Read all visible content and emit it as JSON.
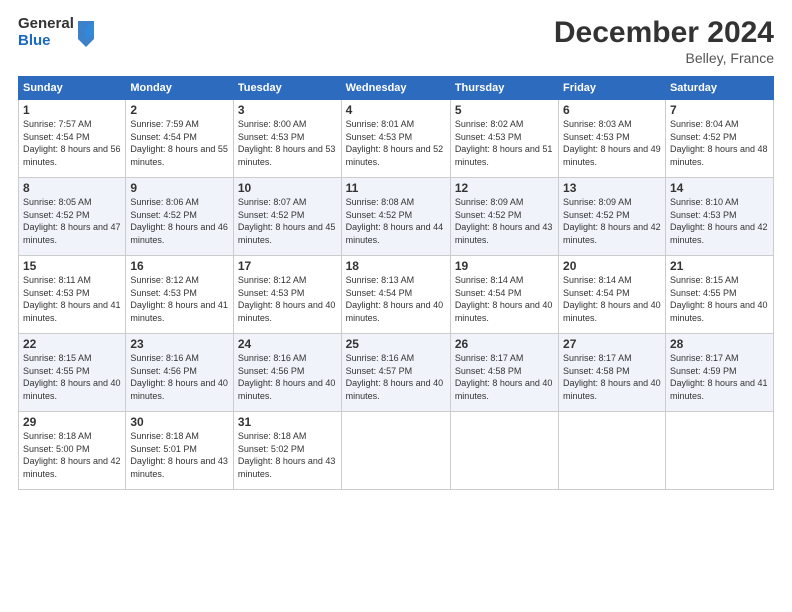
{
  "header": {
    "logo_general": "General",
    "logo_blue": "Blue",
    "month_title": "December 2024",
    "location": "Belley, France"
  },
  "weekdays": [
    "Sunday",
    "Monday",
    "Tuesday",
    "Wednesday",
    "Thursday",
    "Friday",
    "Saturday"
  ],
  "weeks": [
    [
      {
        "day": "1",
        "sunrise": "Sunrise: 7:57 AM",
        "sunset": "Sunset: 4:54 PM",
        "daylight": "Daylight: 8 hours and 56 minutes."
      },
      {
        "day": "2",
        "sunrise": "Sunrise: 7:59 AM",
        "sunset": "Sunset: 4:54 PM",
        "daylight": "Daylight: 8 hours and 55 minutes."
      },
      {
        "day": "3",
        "sunrise": "Sunrise: 8:00 AM",
        "sunset": "Sunset: 4:53 PM",
        "daylight": "Daylight: 8 hours and 53 minutes."
      },
      {
        "day": "4",
        "sunrise": "Sunrise: 8:01 AM",
        "sunset": "Sunset: 4:53 PM",
        "daylight": "Daylight: 8 hours and 52 minutes."
      },
      {
        "day": "5",
        "sunrise": "Sunrise: 8:02 AM",
        "sunset": "Sunset: 4:53 PM",
        "daylight": "Daylight: 8 hours and 51 minutes."
      },
      {
        "day": "6",
        "sunrise": "Sunrise: 8:03 AM",
        "sunset": "Sunset: 4:53 PM",
        "daylight": "Daylight: 8 hours and 49 minutes."
      },
      {
        "day": "7",
        "sunrise": "Sunrise: 8:04 AM",
        "sunset": "Sunset: 4:52 PM",
        "daylight": "Daylight: 8 hours and 48 minutes."
      }
    ],
    [
      {
        "day": "8",
        "sunrise": "Sunrise: 8:05 AM",
        "sunset": "Sunset: 4:52 PM",
        "daylight": "Daylight: 8 hours and 47 minutes."
      },
      {
        "day": "9",
        "sunrise": "Sunrise: 8:06 AM",
        "sunset": "Sunset: 4:52 PM",
        "daylight": "Daylight: 8 hours and 46 minutes."
      },
      {
        "day": "10",
        "sunrise": "Sunrise: 8:07 AM",
        "sunset": "Sunset: 4:52 PM",
        "daylight": "Daylight: 8 hours and 45 minutes."
      },
      {
        "day": "11",
        "sunrise": "Sunrise: 8:08 AM",
        "sunset": "Sunset: 4:52 PM",
        "daylight": "Daylight: 8 hours and 44 minutes."
      },
      {
        "day": "12",
        "sunrise": "Sunrise: 8:09 AM",
        "sunset": "Sunset: 4:52 PM",
        "daylight": "Daylight: 8 hours and 43 minutes."
      },
      {
        "day": "13",
        "sunrise": "Sunrise: 8:09 AM",
        "sunset": "Sunset: 4:52 PM",
        "daylight": "Daylight: 8 hours and 42 minutes."
      },
      {
        "day": "14",
        "sunrise": "Sunrise: 8:10 AM",
        "sunset": "Sunset: 4:53 PM",
        "daylight": "Daylight: 8 hours and 42 minutes."
      }
    ],
    [
      {
        "day": "15",
        "sunrise": "Sunrise: 8:11 AM",
        "sunset": "Sunset: 4:53 PM",
        "daylight": "Daylight: 8 hours and 41 minutes."
      },
      {
        "day": "16",
        "sunrise": "Sunrise: 8:12 AM",
        "sunset": "Sunset: 4:53 PM",
        "daylight": "Daylight: 8 hours and 41 minutes."
      },
      {
        "day": "17",
        "sunrise": "Sunrise: 8:12 AM",
        "sunset": "Sunset: 4:53 PM",
        "daylight": "Daylight: 8 hours and 40 minutes."
      },
      {
        "day": "18",
        "sunrise": "Sunrise: 8:13 AM",
        "sunset": "Sunset: 4:54 PM",
        "daylight": "Daylight: 8 hours and 40 minutes."
      },
      {
        "day": "19",
        "sunrise": "Sunrise: 8:14 AM",
        "sunset": "Sunset: 4:54 PM",
        "daylight": "Daylight: 8 hours and 40 minutes."
      },
      {
        "day": "20",
        "sunrise": "Sunrise: 8:14 AM",
        "sunset": "Sunset: 4:54 PM",
        "daylight": "Daylight: 8 hours and 40 minutes."
      },
      {
        "day": "21",
        "sunrise": "Sunrise: 8:15 AM",
        "sunset": "Sunset: 4:55 PM",
        "daylight": "Daylight: 8 hours and 40 minutes."
      }
    ],
    [
      {
        "day": "22",
        "sunrise": "Sunrise: 8:15 AM",
        "sunset": "Sunset: 4:55 PM",
        "daylight": "Daylight: 8 hours and 40 minutes."
      },
      {
        "day": "23",
        "sunrise": "Sunrise: 8:16 AM",
        "sunset": "Sunset: 4:56 PM",
        "daylight": "Daylight: 8 hours and 40 minutes."
      },
      {
        "day": "24",
        "sunrise": "Sunrise: 8:16 AM",
        "sunset": "Sunset: 4:56 PM",
        "daylight": "Daylight: 8 hours and 40 minutes."
      },
      {
        "day": "25",
        "sunrise": "Sunrise: 8:16 AM",
        "sunset": "Sunset: 4:57 PM",
        "daylight": "Daylight: 8 hours and 40 minutes."
      },
      {
        "day": "26",
        "sunrise": "Sunrise: 8:17 AM",
        "sunset": "Sunset: 4:58 PM",
        "daylight": "Daylight: 8 hours and 40 minutes."
      },
      {
        "day": "27",
        "sunrise": "Sunrise: 8:17 AM",
        "sunset": "Sunset: 4:58 PM",
        "daylight": "Daylight: 8 hours and 40 minutes."
      },
      {
        "day": "28",
        "sunrise": "Sunrise: 8:17 AM",
        "sunset": "Sunset: 4:59 PM",
        "daylight": "Daylight: 8 hours and 41 minutes."
      }
    ],
    [
      {
        "day": "29",
        "sunrise": "Sunrise: 8:18 AM",
        "sunset": "Sunset: 5:00 PM",
        "daylight": "Daylight: 8 hours and 42 minutes."
      },
      {
        "day": "30",
        "sunrise": "Sunrise: 8:18 AM",
        "sunset": "Sunset: 5:01 PM",
        "daylight": "Daylight: 8 hours and 43 minutes."
      },
      {
        "day": "31",
        "sunrise": "Sunrise: 8:18 AM",
        "sunset": "Sunset: 5:02 PM",
        "daylight": "Daylight: 8 hours and 43 minutes."
      },
      null,
      null,
      null,
      null
    ]
  ]
}
